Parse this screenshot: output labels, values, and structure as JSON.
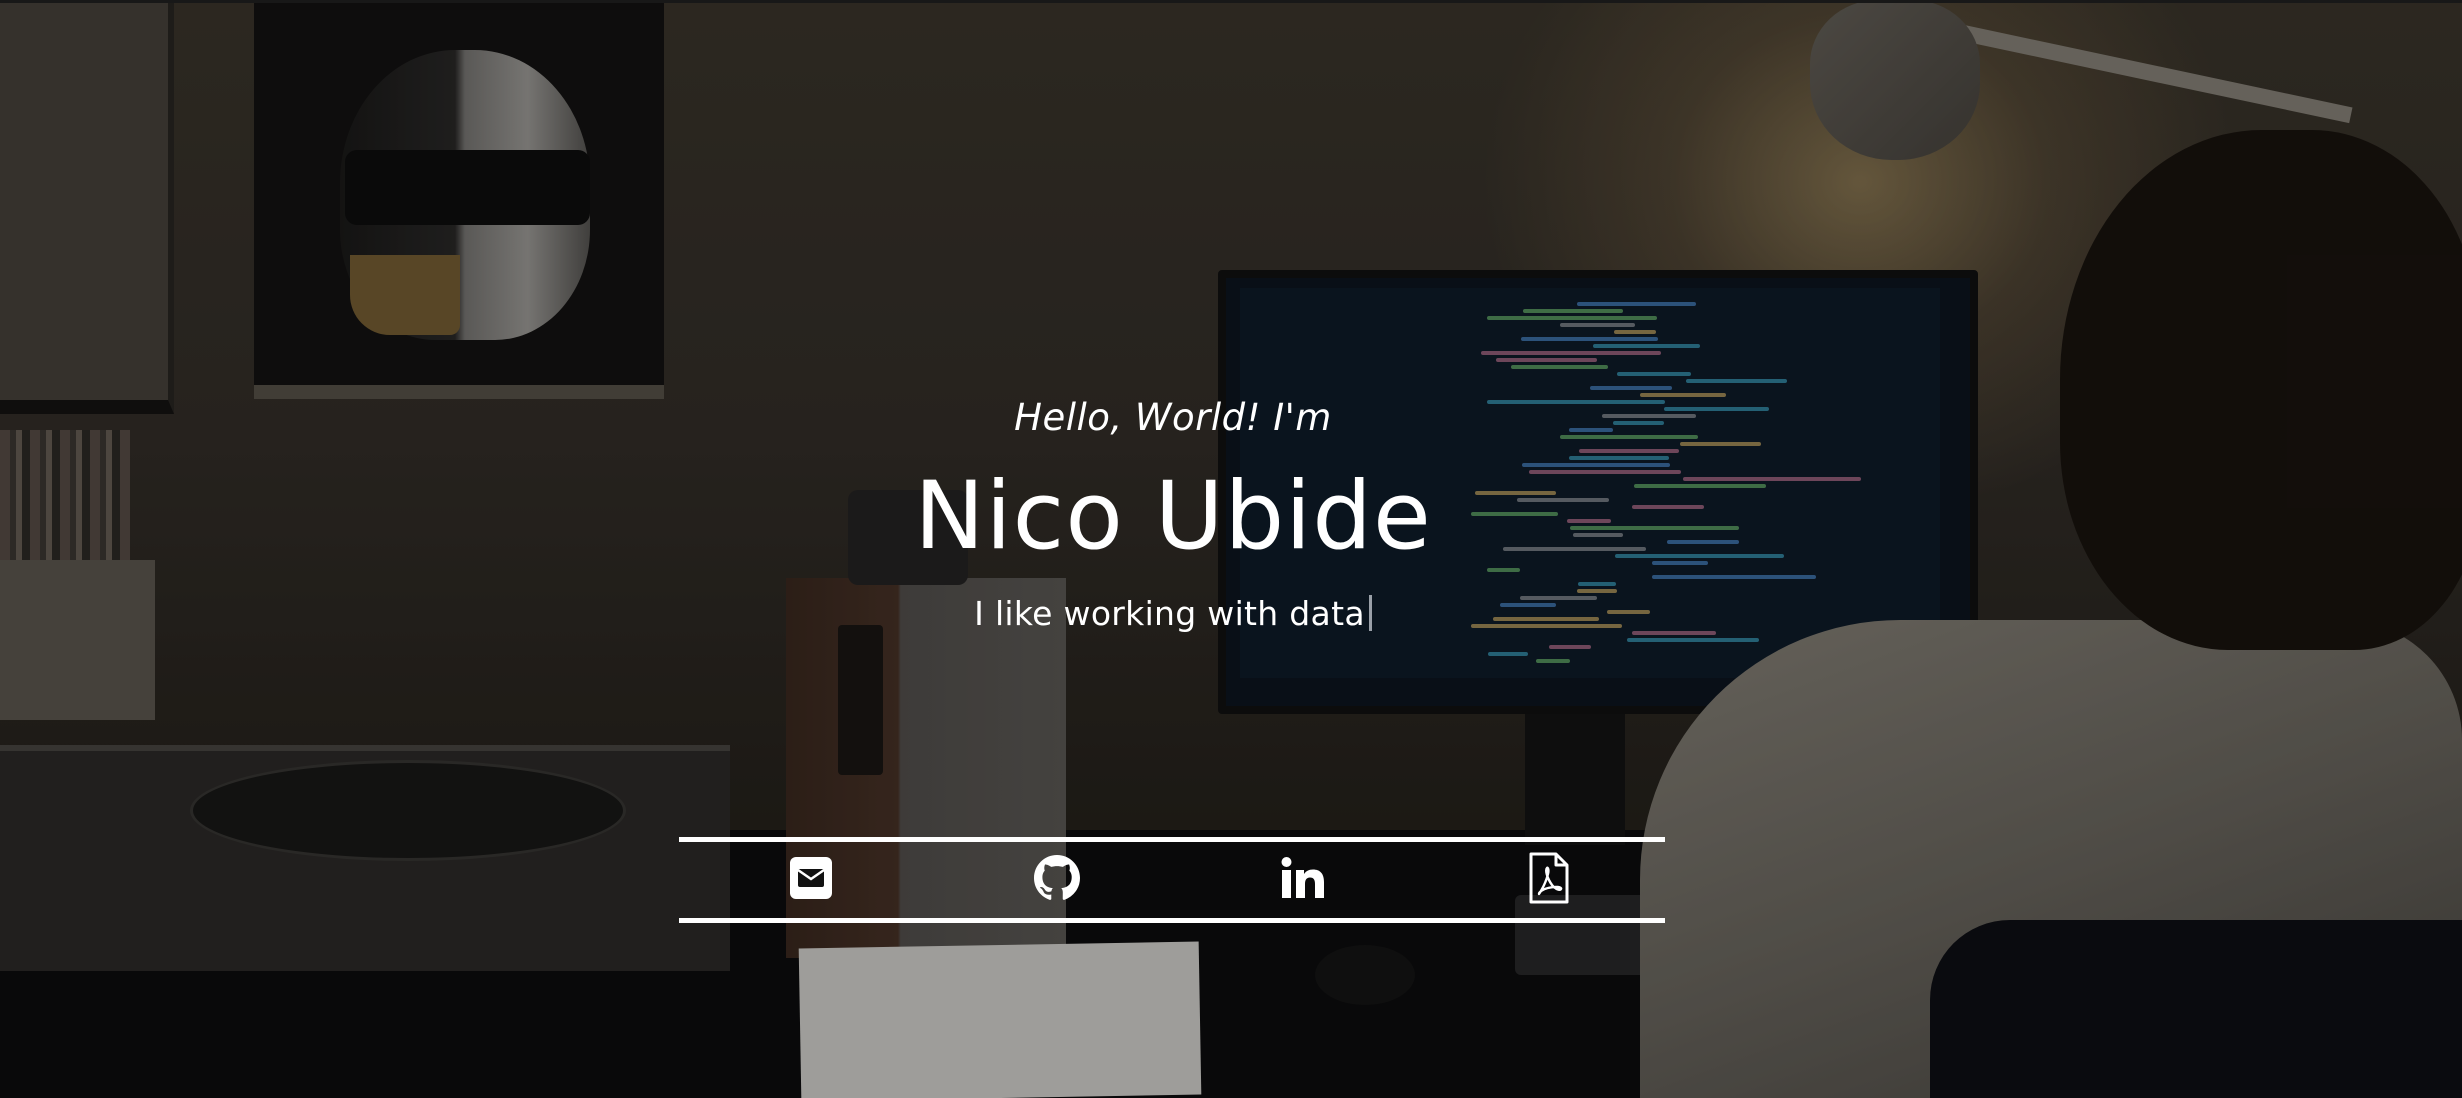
{
  "hero": {
    "greeting": "Hello, World! I'm",
    "name": "Nico Ubide",
    "tagline": "I like working with data"
  },
  "social": [
    {
      "icon": "envelope-icon",
      "label": "email"
    },
    {
      "icon": "github-icon",
      "label": "github"
    },
    {
      "icon": "linkedin-icon",
      "label": "linkedin"
    },
    {
      "icon": "pdf-icon",
      "label": "resume pdf"
    }
  ],
  "colors": {
    "text": "#ffffff",
    "overlay": "rgba(0,0,0,0.28)"
  }
}
